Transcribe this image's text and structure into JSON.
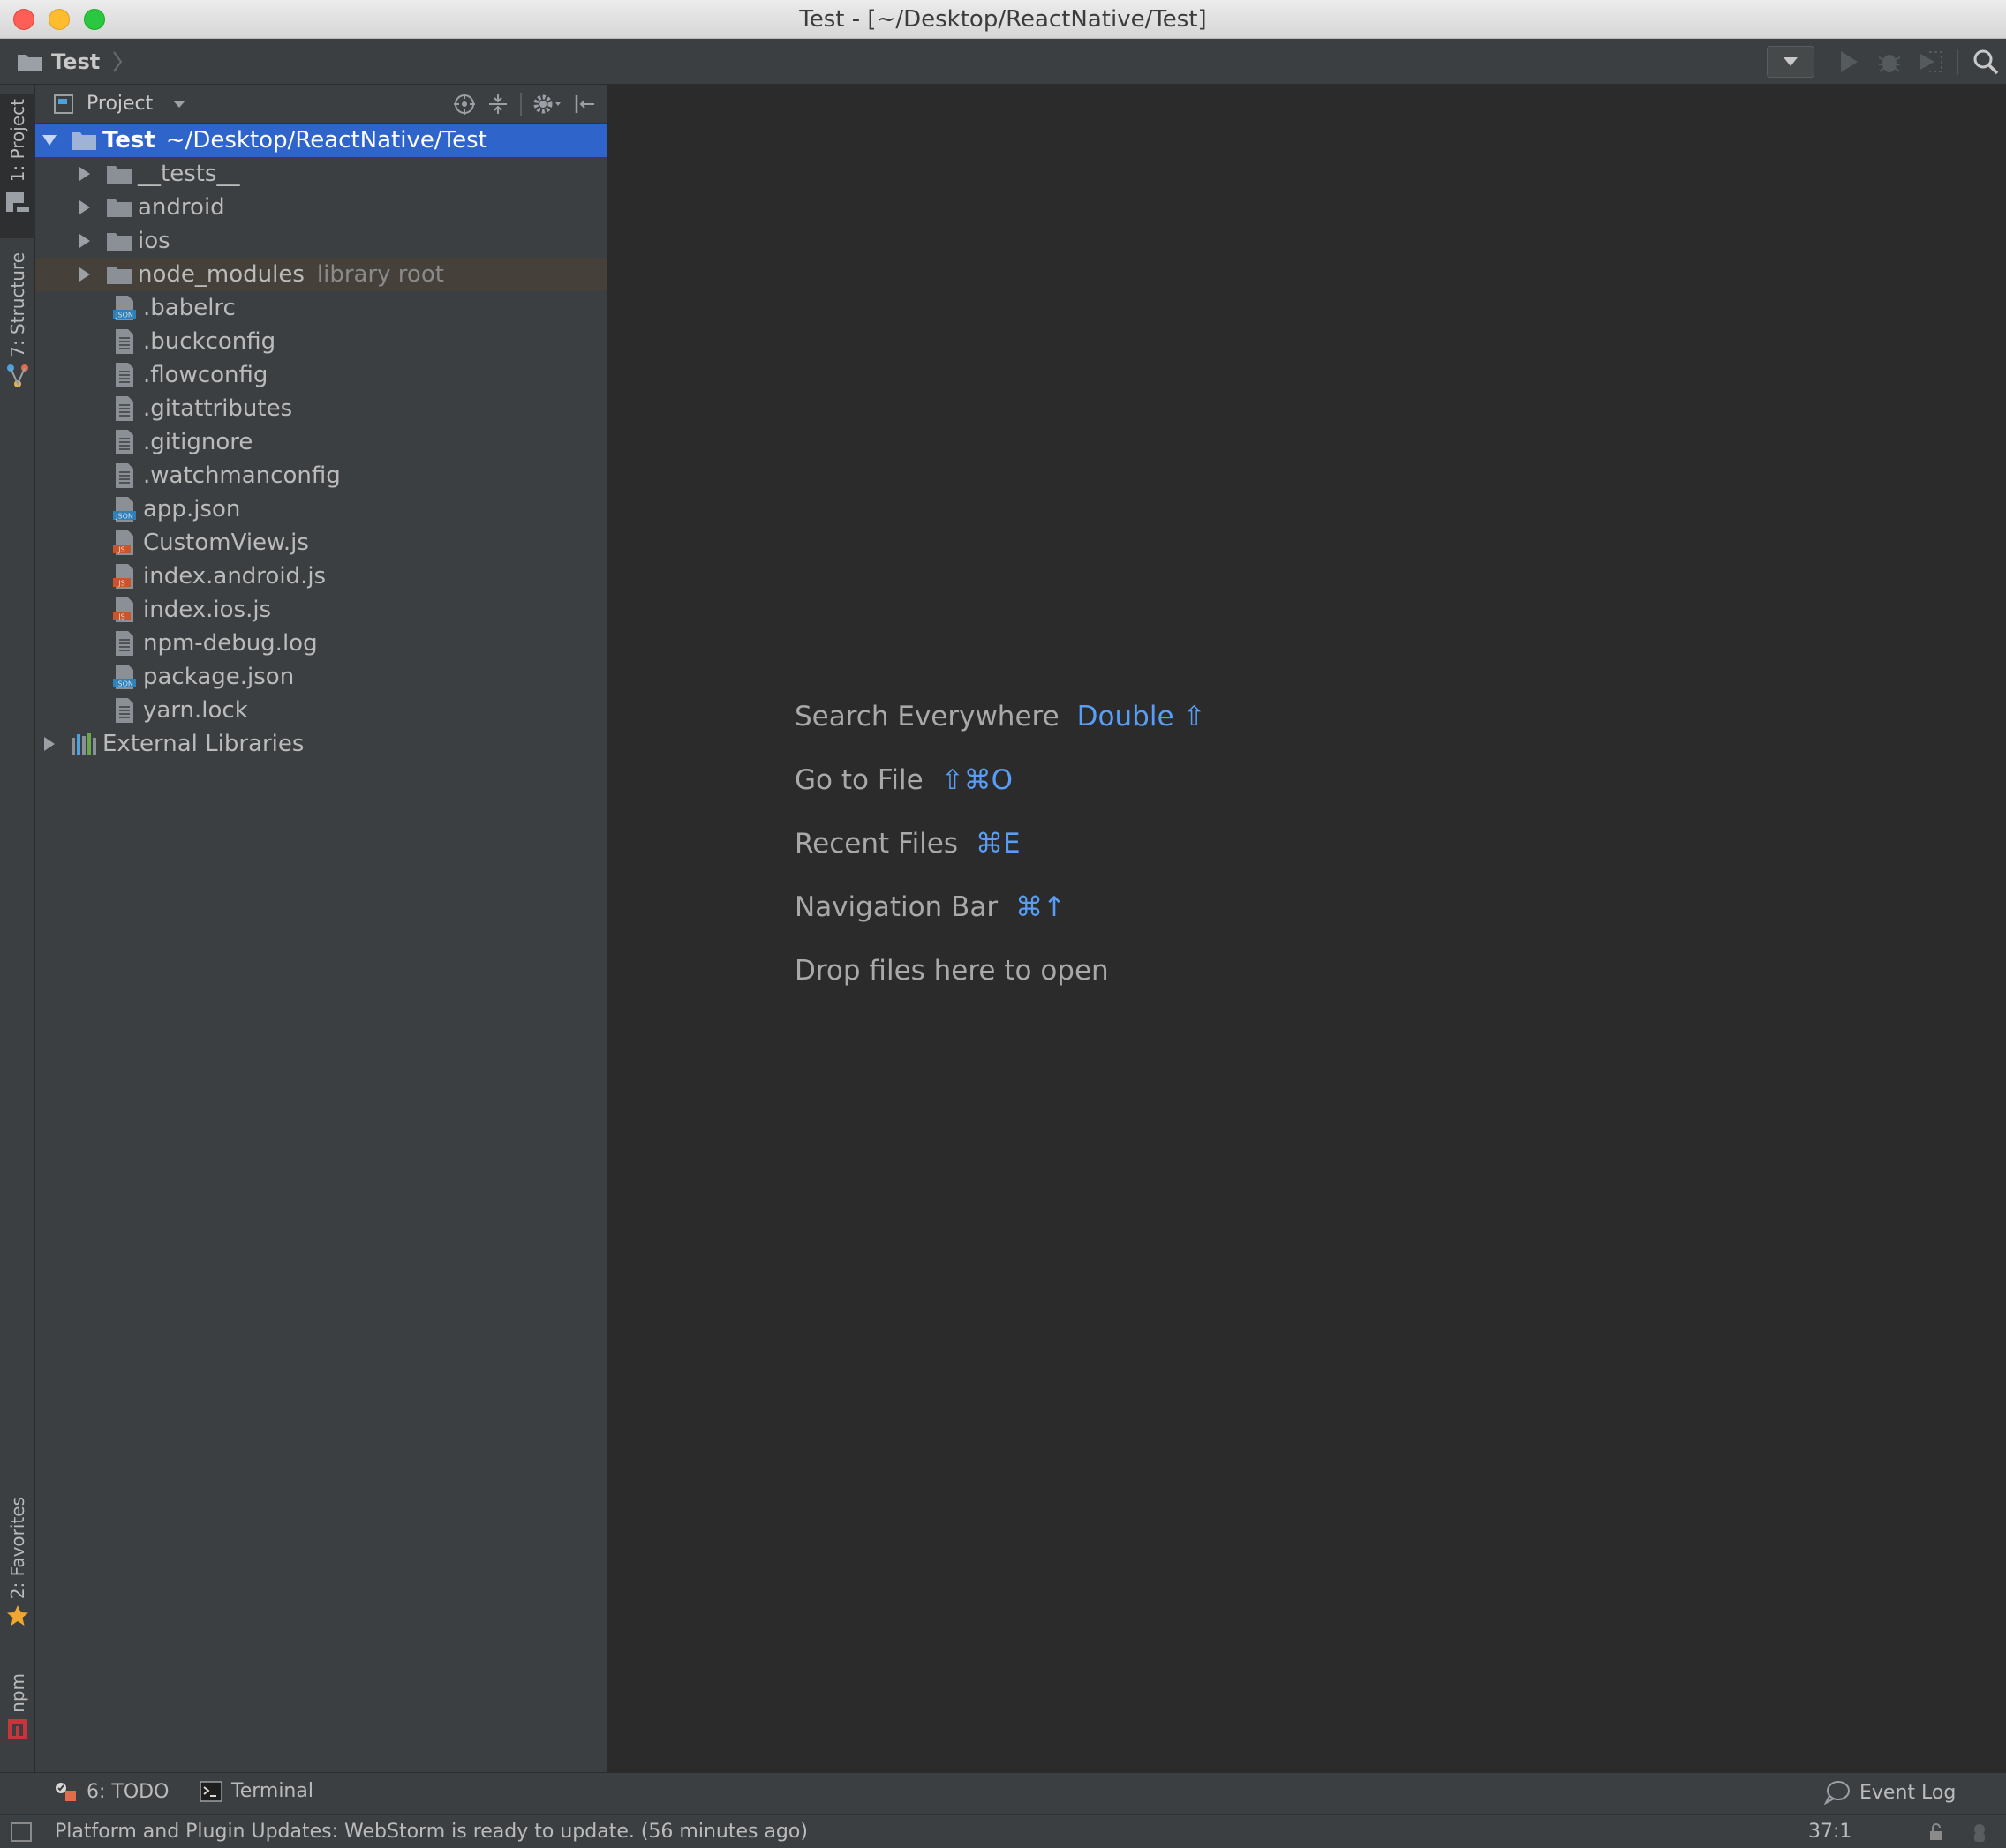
{
  "window": {
    "title": "Test - [~/Desktop/ReactNative/Test]"
  },
  "navbar": {
    "breadcrumb": "Test"
  },
  "left_stripe": {
    "tabs": [
      {
        "label": "1: Project",
        "icon": "project-icon",
        "active": true
      },
      {
        "label": "7: Structure",
        "icon": "structure-icon",
        "active": false
      },
      {
        "label": "2: Favorites",
        "icon": "star-icon",
        "active": false
      },
      {
        "label": "npm",
        "icon": "npm-icon",
        "active": false
      }
    ]
  },
  "project_panel": {
    "title": "Project",
    "root": {
      "name": "Test",
      "path": "~/Desktop/ReactNative/Test"
    },
    "folders": [
      {
        "name": "__tests__",
        "hint": ""
      },
      {
        "name": "android",
        "hint": ""
      },
      {
        "name": "ios",
        "hint": ""
      },
      {
        "name": "node_modules",
        "hint": "library root"
      }
    ],
    "files": [
      {
        "name": ".babelrc",
        "type": "json"
      },
      {
        "name": ".buckconfig",
        "type": "text"
      },
      {
        "name": ".flowconfig",
        "type": "text"
      },
      {
        "name": ".gitattributes",
        "type": "text"
      },
      {
        "name": ".gitignore",
        "type": "text"
      },
      {
        "name": ".watchmanconfig",
        "type": "text"
      },
      {
        "name": "app.json",
        "type": "json"
      },
      {
        "name": "CustomView.js",
        "type": "js"
      },
      {
        "name": "index.android.js",
        "type": "js"
      },
      {
        "name": "index.ios.js",
        "type": "js"
      },
      {
        "name": "npm-debug.log",
        "type": "text"
      },
      {
        "name": "package.json",
        "type": "json"
      },
      {
        "name": "yarn.lock",
        "type": "text"
      }
    ],
    "external": "External Libraries"
  },
  "editor": {
    "hints": [
      {
        "label": "Search Everywhere",
        "key": "Double ⇧"
      },
      {
        "label": "Go to File",
        "key": "⇧⌘O"
      },
      {
        "label": "Recent Files",
        "key": "⌘E"
      },
      {
        "label": "Navigation Bar",
        "key": "⌘↑"
      },
      {
        "label": "Drop files here to open",
        "key": ""
      }
    ]
  },
  "bottom_bar": {
    "todo": "6: TODO",
    "terminal": "Terminal",
    "event_log": "Event Log"
  },
  "status_bar": {
    "message": "Platform and Plugin Updates: WebStorm is ready to update. (56 minutes ago)",
    "position": "37:1"
  },
  "colors": {
    "selection": "#2f65ca",
    "hint_key": "#589df6",
    "library_root_bg": "#45403a"
  }
}
